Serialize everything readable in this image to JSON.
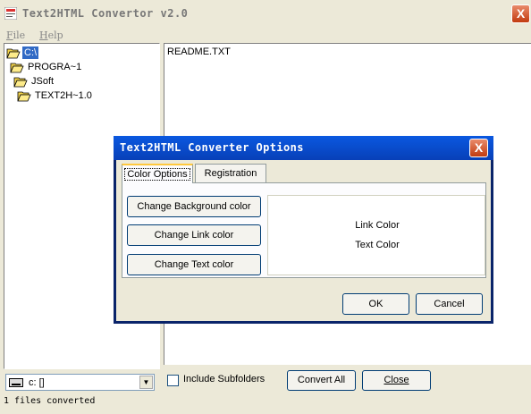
{
  "window": {
    "title": "Text2HTML Convertor v2.0",
    "close_label": "X"
  },
  "menu": [
    {
      "label": "File",
      "accel": "F"
    },
    {
      "label": "Help",
      "accel": "H"
    }
  ],
  "tree": [
    {
      "label": "C:\\",
      "selected": true
    },
    {
      "label": "PROGRA~1",
      "selected": false
    },
    {
      "label": "JSoft",
      "selected": false
    },
    {
      "label": "TEXT2H~1.0",
      "selected": false
    }
  ],
  "files": [
    "README.TXT"
  ],
  "drive": {
    "label": "c: []"
  },
  "include_subfolders": {
    "label": "Include Subfolders",
    "checked": false
  },
  "buttons": {
    "convert_all": "Convert All",
    "close": "Close"
  },
  "status": "1 files converted",
  "dialog": {
    "title": "Text2HTML Converter Options",
    "close_label": "X",
    "tabs": [
      {
        "label": "Color Options",
        "active": true
      },
      {
        "label": "Registration",
        "active": false
      }
    ],
    "option_buttons": [
      "Change Background color",
      "Change Link color",
      "Change Text color"
    ],
    "preview": {
      "link": "Link Color",
      "text": "Text Color"
    },
    "ok": "OK",
    "cancel": "Cancel"
  },
  "colors": {
    "selection": "#316AC5",
    "dialog_title": "#0A58E0",
    "close_button": "#C23B10",
    "face": "#ECE9D8"
  }
}
